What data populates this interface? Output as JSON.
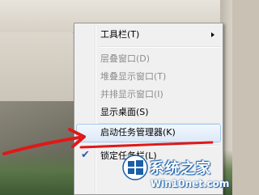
{
  "context_menu": {
    "items": [
      {
        "label": "工具栏(T)",
        "enabled": true,
        "submenu": true
      },
      {
        "label": "层叠窗口(D)",
        "enabled": false
      },
      {
        "label": "堆叠显示窗口(T)",
        "enabled": false
      },
      {
        "label": "并排显示窗口(I)",
        "enabled": false
      },
      {
        "label": "显示桌面(S)",
        "enabled": true
      },
      {
        "label": "启动任务管理器(K)",
        "enabled": true,
        "highlighted": true
      },
      {
        "label": "锁定任务栏(L)",
        "enabled": true,
        "checked": true
      }
    ]
  },
  "annotation": {
    "color": "#e01818",
    "shape": "arrow"
  },
  "watermark": {
    "logo_icon": "windows-logo-icon",
    "title": "系统之家",
    "url": "Win10net.com",
    "color": "#1a5fa8"
  }
}
